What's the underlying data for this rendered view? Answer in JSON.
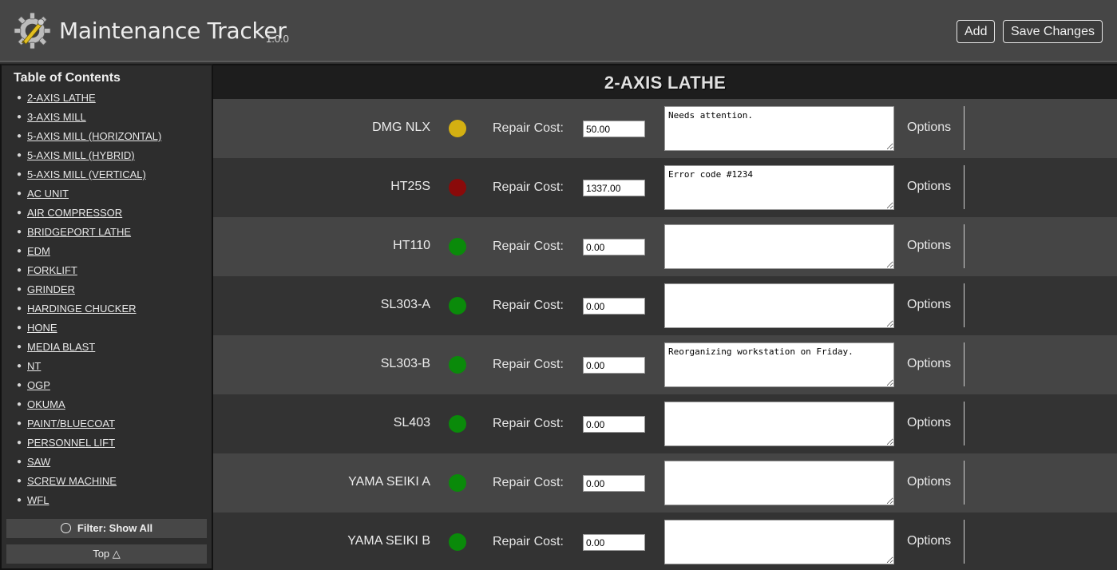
{
  "header": {
    "title": "Maintenance Tracker",
    "version": "1.0.0",
    "add_label": "Add",
    "save_label": "Save Changes"
  },
  "sidebar": {
    "title": "Table of Contents",
    "items": [
      "2-AXIS LATHE",
      "3-AXIS MILL",
      "5-AXIS MILL (HORIZONTAL)",
      "5-AXIS MILL (HYBRID)",
      "5-AXIS MILL (VERTICAL)",
      "AC UNIT",
      "AIR COMPRESSOR",
      "BRIDGEPORT LATHE",
      "EDM",
      "FORKLIFT",
      "GRINDER",
      "HARDINGE CHUCKER",
      "HONE",
      "MEDIA BLAST",
      "NT",
      "OGP",
      "OKUMA",
      "PAINT/BLUECOAT",
      "PERSONNEL LIFT",
      "SAW",
      "SCREW MACHINE",
      "WFL"
    ],
    "filter_label": "Filter: Show All",
    "top_label": "Top △"
  },
  "section": {
    "title": "2-AXIS LATHE",
    "cost_label": "Repair Cost:",
    "options_label": "Options",
    "machines": [
      {
        "name": "DMG NLX",
        "status": "warning",
        "status_color": "#d4b012",
        "cost": "50.00",
        "notes": "Needs attention."
      },
      {
        "name": "HT25S",
        "status": "down",
        "status_color": "#8a0a0a",
        "cost": "1337.00",
        "notes": "Error code #1234"
      },
      {
        "name": "HT110",
        "status": "ok",
        "status_color": "#0a8a0a",
        "cost": "0.00",
        "notes": ""
      },
      {
        "name": "SL303-A",
        "status": "ok",
        "status_color": "#0a8a0a",
        "cost": "0.00",
        "notes": ""
      },
      {
        "name": "SL303-B",
        "status": "ok",
        "status_color": "#0a8a0a",
        "cost": "0.00",
        "notes": "Reorganizing workstation on Friday."
      },
      {
        "name": "SL403",
        "status": "ok",
        "status_color": "#0a8a0a",
        "cost": "0.00",
        "notes": ""
      },
      {
        "name": "YAMA SEIKI A",
        "status": "ok",
        "status_color": "#0a8a0a",
        "cost": "0.00",
        "notes": ""
      },
      {
        "name": "YAMA SEIKI B",
        "status": "ok",
        "status_color": "#0a8a0a",
        "cost": "0.00",
        "notes": ""
      }
    ]
  }
}
